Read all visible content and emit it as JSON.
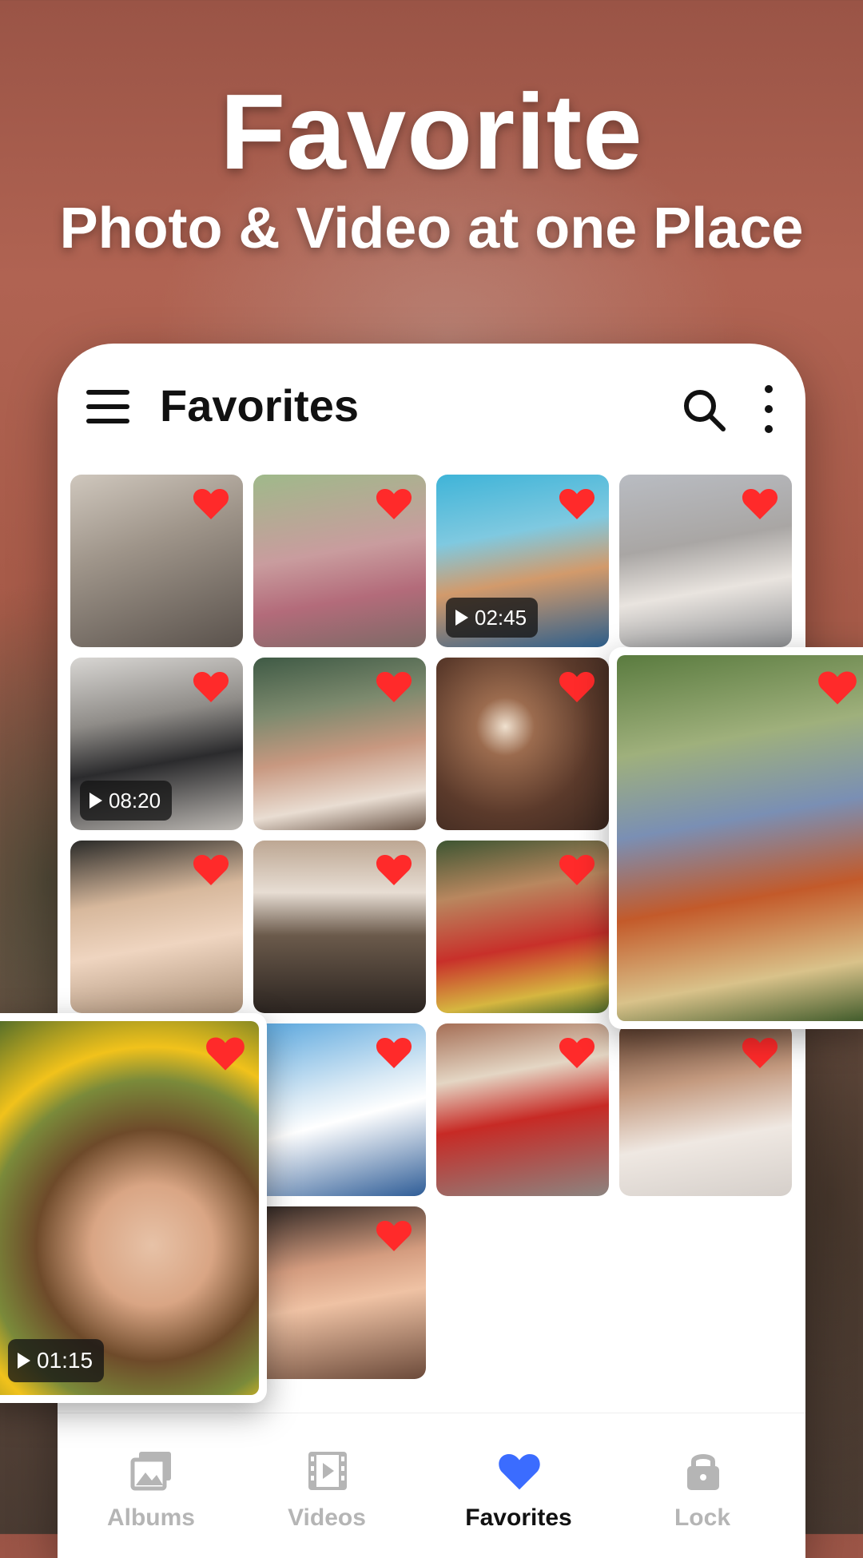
{
  "promo": {
    "headline": "Favorite",
    "subheadline": "Photo & Video at one Place"
  },
  "app_bar": {
    "title": "Favorites",
    "icons": [
      "menu-icon",
      "search-icon",
      "more-vert-icon"
    ]
  },
  "colors": {
    "accent": "#3b6cff",
    "heart": "#ff2a2a",
    "inactive": "#b5b5b5",
    "text": "#111111"
  },
  "grid": {
    "items": [
      {
        "type": "photo",
        "favorite": true
      },
      {
        "type": "photo",
        "favorite": true
      },
      {
        "type": "video",
        "favorite": true,
        "duration": "02:45"
      },
      {
        "type": "photo",
        "favorite": true
      },
      {
        "type": "video",
        "favorite": true,
        "duration": "08:20"
      },
      {
        "type": "photo",
        "favorite": true
      },
      {
        "type": "photo",
        "favorite": true
      },
      {
        "type": "photo",
        "favorite": true
      },
      {
        "type": "photo",
        "favorite": true
      },
      {
        "type": "photo",
        "favorite": true
      },
      {
        "type": "photo",
        "favorite": true
      },
      {
        "type": "photo",
        "favorite": true
      },
      {
        "type": "photo",
        "favorite": true
      },
      {
        "type": "photo",
        "favorite": true
      },
      {
        "type": "photo",
        "favorite": true
      },
      {
        "type": "photo",
        "favorite": true
      }
    ],
    "featured": [
      {
        "type": "photo",
        "favorite": true
      },
      {
        "type": "video",
        "favorite": true,
        "duration": "01:15"
      }
    ]
  },
  "bottom_nav": {
    "items": [
      {
        "label": "Albums",
        "icon": "albums-icon",
        "active": false
      },
      {
        "label": "Videos",
        "icon": "videos-icon",
        "active": false
      },
      {
        "label": "Favorites",
        "icon": "heart-icon",
        "active": true
      },
      {
        "label": "Lock",
        "icon": "lock-icon",
        "active": false
      }
    ]
  }
}
